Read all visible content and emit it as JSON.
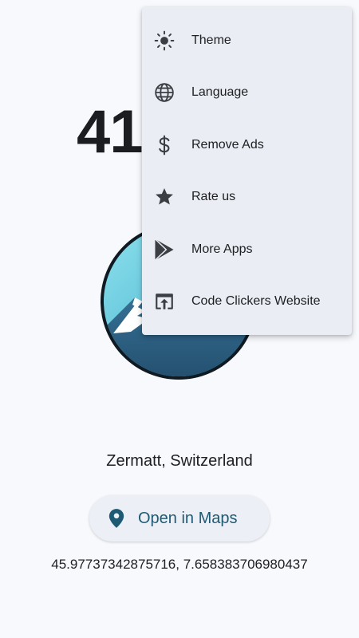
{
  "main": {
    "altitude": "41",
    "place": "Zermatt, Switzerland",
    "open_maps_label": "Open in Maps",
    "coordinates": "45.97737342875716, 7.658383706980437"
  },
  "menu": {
    "items": [
      {
        "label": "Theme",
        "icon": "brightness-icon"
      },
      {
        "label": "Language",
        "icon": "globe-icon"
      },
      {
        "label": "Remove Ads",
        "icon": "dollar-icon"
      },
      {
        "label": "Rate us",
        "icon": "star-icon"
      },
      {
        "label": "More Apps",
        "icon": "play-store-icon"
      },
      {
        "label": "Code Clickers Website",
        "icon": "open-in-browser-icon"
      }
    ]
  },
  "colors": {
    "background": "#f7f9fd",
    "menu_background": "#eaedf3",
    "maps_accent": "#1e5a73",
    "text": "#1d1f22"
  }
}
